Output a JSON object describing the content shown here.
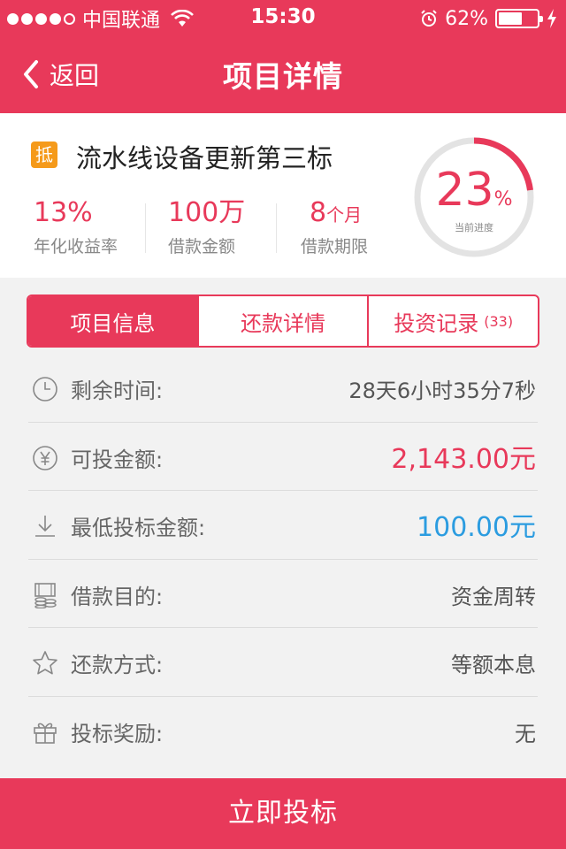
{
  "status_bar": {
    "carrier": "中国联通",
    "time": "15:30",
    "battery": "62%",
    "battery_level": 0.62,
    "signal_bars": 4
  },
  "nav": {
    "back_label": "返回",
    "title": "项目详情"
  },
  "project": {
    "tag": "抵",
    "title": "流水线设备更新第三标",
    "stats": [
      {
        "value": "13%",
        "unit": "",
        "label": "年化收益率"
      },
      {
        "value": "100万",
        "unit": "",
        "label": "借款金额"
      },
      {
        "value": "8",
        "unit": "个月",
        "label": "借款期限"
      }
    ],
    "progress": {
      "value": "23",
      "unit": "%",
      "label": "当前进度",
      "fraction": 0.23
    }
  },
  "tabs": [
    {
      "label": "项目信息",
      "active": true,
      "count": ""
    },
    {
      "label": "还款详情",
      "active": false,
      "count": ""
    },
    {
      "label": "投资记录",
      "active": false,
      "count": "(33)"
    }
  ],
  "info": [
    {
      "icon": "clock-icon",
      "label": "剩余时间:",
      "value": "28天6小时35分7秒",
      "style": "plain"
    },
    {
      "icon": "yen-icon",
      "label": "可投金额:",
      "value": "2,143.00元",
      "style": "red"
    },
    {
      "icon": "download-icon",
      "label": "最低投标金额:",
      "value": "100.00元",
      "style": "blue"
    },
    {
      "icon": "coins-icon",
      "label": "借款目的:",
      "value": "资金周转",
      "style": "plain"
    },
    {
      "icon": "star-icon",
      "label": "还款方式:",
      "value": "等额本息",
      "style": "plain"
    },
    {
      "icon": "gift-icon",
      "label": "投标奖励:",
      "value": "无",
      "style": "plain"
    }
  ],
  "action": {
    "invest_label": "立即投标"
  },
  "colors": {
    "brand": "#e8395a",
    "accent_orange": "#f59a1a",
    "blue": "#2b9ce0"
  }
}
